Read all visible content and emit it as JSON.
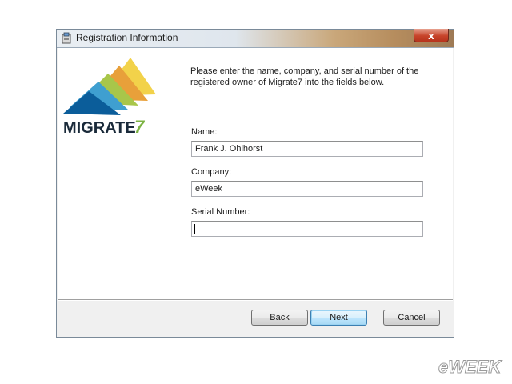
{
  "window": {
    "title": "Registration Information",
    "close_label": "x"
  },
  "logo": {
    "text": "MIGRATE7",
    "colors": [
      "#f2c94c",
      "#e58a2e",
      "#9bbf3a",
      "#1f7fb8",
      "#0b4f8a"
    ]
  },
  "intro_text": "Please enter the name, company, and serial number of the registered owner of Migrate7 into the fields below.",
  "fields": {
    "name": {
      "label": "Name:",
      "value": "Frank J. Ohlhorst"
    },
    "company": {
      "label": "Company:",
      "value": "eWeek"
    },
    "serial": {
      "label": "Serial Number:",
      "value": ""
    }
  },
  "buttons": {
    "back": "Back",
    "next": "Next",
    "cancel": "Cancel"
  },
  "watermark": {
    "text": "eWEEK"
  },
  "colors": {
    "close_red": "#c7442a",
    "default_button_border": "#3c7fb1",
    "watermark_text": "#ffffff"
  }
}
